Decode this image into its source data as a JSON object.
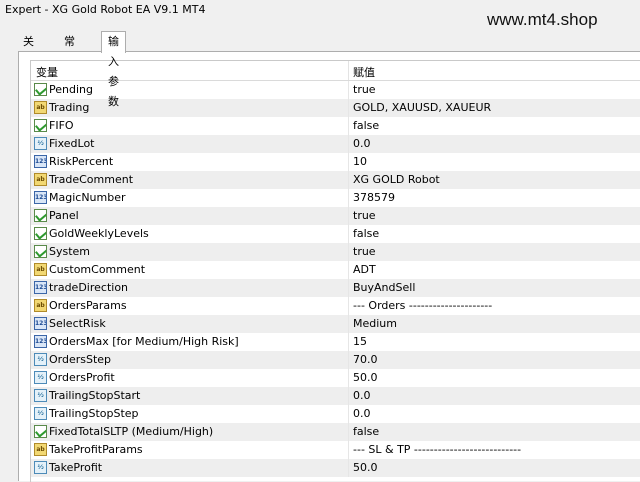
{
  "window_title": "Expert - XG Gold Robot EA V9.1 MT4",
  "watermark": "www.mt4.shop",
  "tabs": [
    {
      "label": "关于"
    },
    {
      "label": "常用"
    },
    {
      "label": "输入参数",
      "active": true
    }
  ],
  "table": {
    "columns": [
      "变量",
      "赋值"
    ],
    "rows": [
      {
        "type": "bool",
        "name": "Pending",
        "value": "true"
      },
      {
        "type": "string",
        "name": "Trading",
        "value": "GOLD, XAUUSD, XAUEUR"
      },
      {
        "type": "bool",
        "name": "FIFO",
        "value": "false"
      },
      {
        "type": "double",
        "name": "FixedLot",
        "value": "0.0"
      },
      {
        "type": "int",
        "name": "RiskPercent",
        "value": "10"
      },
      {
        "type": "string",
        "name": "TradeComment",
        "value": "XG GOLD Robot"
      },
      {
        "type": "int",
        "name": "MagicNumber",
        "value": "378579"
      },
      {
        "type": "bool",
        "name": "Panel",
        "value": "true"
      },
      {
        "type": "bool",
        "name": "GoldWeeklyLevels",
        "value": "false"
      },
      {
        "type": "bool",
        "name": "System",
        "value": "true"
      },
      {
        "type": "string",
        "name": "CustomComment",
        "value": "ADT"
      },
      {
        "type": "int",
        "name": "tradeDirection",
        "value": "BuyAndSell"
      },
      {
        "type": "string",
        "name": "OrdersParams",
        "value": "--- Orders ---------------------"
      },
      {
        "type": "int",
        "name": "SelectRisk",
        "value": "Medium"
      },
      {
        "type": "int",
        "name": "OrdersMax [for Medium/High Risk]",
        "value": "15"
      },
      {
        "type": "double",
        "name": "OrdersStep",
        "value": "70.0"
      },
      {
        "type": "double",
        "name": "OrdersProfit",
        "value": "50.0"
      },
      {
        "type": "double",
        "name": "TrailingStopStart",
        "value": "0.0"
      },
      {
        "type": "double",
        "name": "TrailingStopStep",
        "value": "0.0"
      },
      {
        "type": "bool",
        "name": "FixedTotalSLTP (Medium/High)",
        "value": "false"
      },
      {
        "type": "string",
        "name": "TakeProfitParams",
        "value": "--- SL & TP ---------------------------"
      },
      {
        "type": "double",
        "name": "TakeProfit",
        "value": "50.0"
      }
    ]
  },
  "icons": {
    "bool": "checkmark-chart-icon",
    "string": "ab-string-icon",
    "int": "123-integer-icon",
    "double": "v2-double-icon"
  },
  "colors": {
    "row_even": "#ffffff",
    "row_odd": "#eeeeee",
    "panel_bg": "#ffffff",
    "window_bg": "#f0f0f0"
  }
}
